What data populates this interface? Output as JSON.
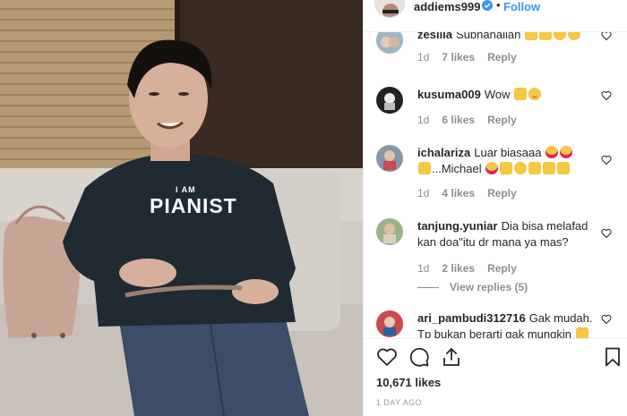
{
  "post": {
    "username": "addiems999",
    "follow_label": "Follow",
    "dot": "•",
    "likes_count": "10,671 likes",
    "time_ago": "1 DAY AGO",
    "shirt_text_small": "I AM",
    "shirt_text_big": "PIANIST"
  },
  "comments": [
    {
      "user": "zesilia",
      "text": "Subhanallah",
      "emojis": [
        "clap",
        "clap",
        "grin",
        "grin"
      ],
      "time": "1d",
      "likes": "7 likes",
      "reply": "Reply"
    },
    {
      "user": "kusuma009",
      "text": "Wow",
      "emojis": [
        "clap",
        "heart-eyes"
      ],
      "time": "1d",
      "likes": "6 likes",
      "reply": "Reply"
    },
    {
      "user": "ichalariza",
      "text": "Luar biasaaa",
      "text2": "...Michael",
      "emojis": [
        "heart-eyes",
        "heart-eyes"
      ],
      "emojis_pre2": [
        "pray"
      ],
      "emojis2": [
        "heart-eyes",
        "pray",
        "grin",
        "clap",
        "clap",
        "clap"
      ],
      "time": "1d",
      "likes": "4 likes",
      "reply": "Reply"
    },
    {
      "user": "tanjung.yuniar",
      "text": "Dia bisa melafad",
      "text2": "kan doa\"itu dr mana ya mas?",
      "time": "1d",
      "likes": "2 likes",
      "reply": "Reply",
      "view_replies": "View replies (5)"
    },
    {
      "user": "ari_pambudi312716",
      "text": "Gak mudah.",
      "text2": "Tp bukan berarti gak mungkin",
      "emojis2": [
        "clap"
      ]
    }
  ],
  "colors": {
    "link": "#3897f0",
    "text": "#262626",
    "muted": "#8e8e8e"
  }
}
